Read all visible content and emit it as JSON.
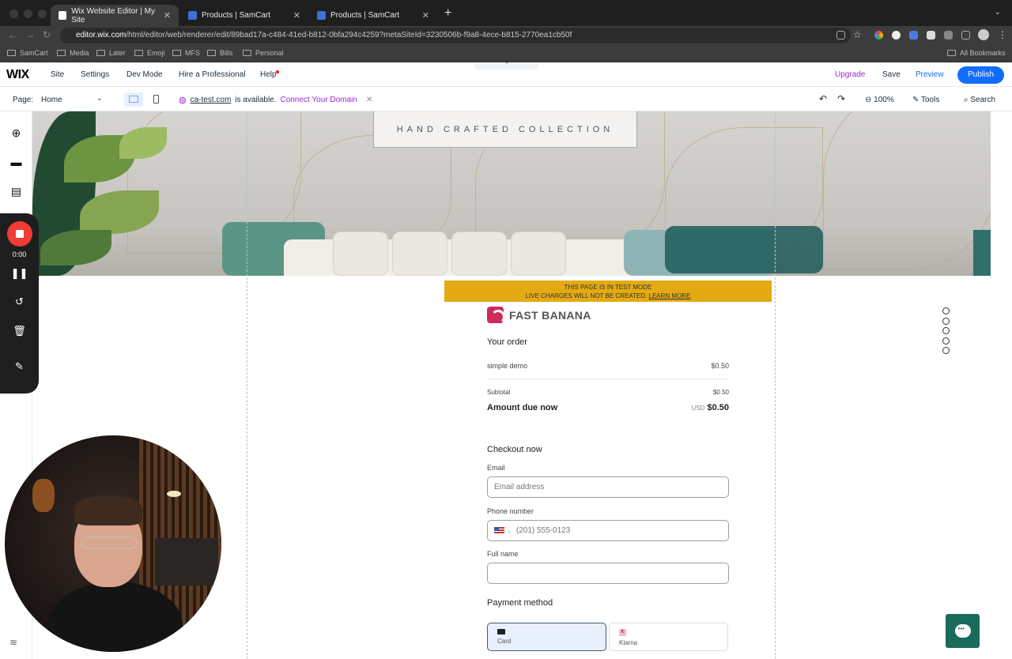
{
  "browser": {
    "tabs": [
      {
        "label": "Wix Website Editor | My Site",
        "active": true
      },
      {
        "label": "Products | SamCart",
        "active": false
      },
      {
        "label": "Products | SamCart",
        "active": false
      }
    ],
    "new_tab": "+",
    "url_host": "editor.wix.com",
    "url_path": "/html/editor/web/renderer/edit/89bad17a-c484-41ed-b812-0bfa294c4259?metaSiteId=3230506b-f9a8-4ece-b815-2770ea1cb50f",
    "bookmarks": [
      "SamCart",
      "Media",
      "Later",
      "Emoji",
      "MFS",
      "Bills",
      "Personal"
    ],
    "all_bookmarks": "All Bookmarks"
  },
  "wix": {
    "logo": "WIX",
    "menu": [
      "Site",
      "Settings",
      "Dev Mode",
      "Hire a Professional",
      "Help"
    ],
    "upgrade": "Upgrade",
    "save": "Save",
    "preview": "Preview",
    "publish": "Publish",
    "page_label": "Page:",
    "page_value": "Home",
    "domain_name": "ca-test.com",
    "domain_available": "is available.",
    "connect_domain": "Connect Your Domain",
    "zoom": "100%",
    "tools": "Tools",
    "search": "Search"
  },
  "recorder": {
    "time": "0:00"
  },
  "site": {
    "collection_text": "HAND CRAFTED COLLECTION"
  },
  "checkout": {
    "test_mode_line1": "THIS PAGE IS IN TEST MODE",
    "test_mode_line2": "LIVE CHARGES WILL NOT BE CREATED.",
    "learn_more": "LEARN MORE",
    "brand": "FAST BANANA",
    "your_order": "Your order",
    "item_name": "simple demo",
    "item_price": "$0.50",
    "subtotal_label": "Subtotal",
    "subtotal_value": "$0.50",
    "amount_due_label": "Amount due now",
    "amount_due_currency": "USD",
    "amount_due_value": "$0.50",
    "checkout_now": "Checkout now",
    "email_label": "Email",
    "email_placeholder": "Email address",
    "phone_label": "Phone number",
    "phone_placeholder": "(201) 555-0123",
    "fullname_label": "Full name",
    "payment_method": "Payment method",
    "pay_card": "Card",
    "pay_klarna": "Klarna"
  },
  "colors": {
    "wix_blue": "#116dff",
    "upgrade_purple": "#9a27d5",
    "test_banner": "#e3aa14",
    "record_red": "#ef3d36",
    "chat_green": "#1b6b5b"
  }
}
